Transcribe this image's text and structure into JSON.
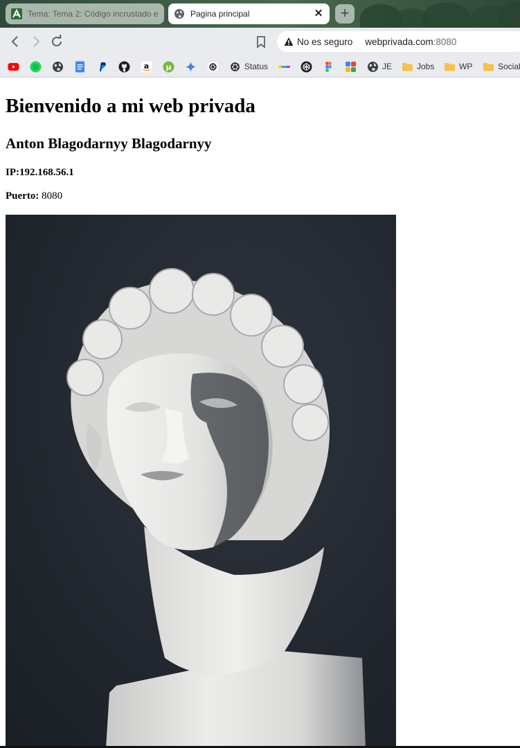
{
  "browser": {
    "tabs": [
      {
        "title": "Tema: Tema 2: Código incrustado e",
        "active": false
      },
      {
        "title": "Pagina principal",
        "active": true
      }
    ],
    "new_tab_label": "+",
    "close_label": "✕",
    "address_bar": {
      "security_label": "No es seguro",
      "host": "webprivada.com",
      "port": ":8080"
    },
    "bookmarks": [
      {
        "icon": "youtube-icon",
        "label": ""
      },
      {
        "icon": "spotify-icon",
        "label": ""
      },
      {
        "icon": "globe-icon",
        "label": ""
      },
      {
        "icon": "docs-icon",
        "label": ""
      },
      {
        "icon": "paypal-icon",
        "label": ""
      },
      {
        "icon": "github-icon",
        "label": ""
      },
      {
        "icon": "amazon-icon",
        "label": ""
      },
      {
        "icon": "utorrent-icon",
        "label": ""
      },
      {
        "icon": "gemini-icon",
        "label": ""
      },
      {
        "icon": "chatgpt-icon",
        "label": ""
      },
      {
        "icon": "openai-icon",
        "label": "Status"
      },
      {
        "icon": "colorbar-icon",
        "label": ""
      },
      {
        "icon": "codepen-icon",
        "label": ""
      },
      {
        "icon": "figma-icon",
        "label": ""
      },
      {
        "icon": "apps-icon",
        "label": ""
      },
      {
        "icon": "globe-icon",
        "label": "JE"
      },
      {
        "icon": "folder-icon",
        "label": "Jobs"
      },
      {
        "icon": "folder-icon",
        "label": "WP"
      },
      {
        "icon": "folder-icon",
        "label": "Social"
      }
    ]
  },
  "page": {
    "heading": "Bienvenido a mi web privada",
    "name": "Anton Blagodarnyy Blagodarnyy",
    "ip_label": "IP:192.168.56.1",
    "port_label": "Puerto:",
    "port_value": "8080",
    "image_icon": "statue-bust-photo"
  },
  "colors": {
    "tab_strip": "#3c5b46",
    "toolbar": "#e9ebee",
    "photo_background": "#252a33",
    "statue": "#e6e6e4"
  }
}
